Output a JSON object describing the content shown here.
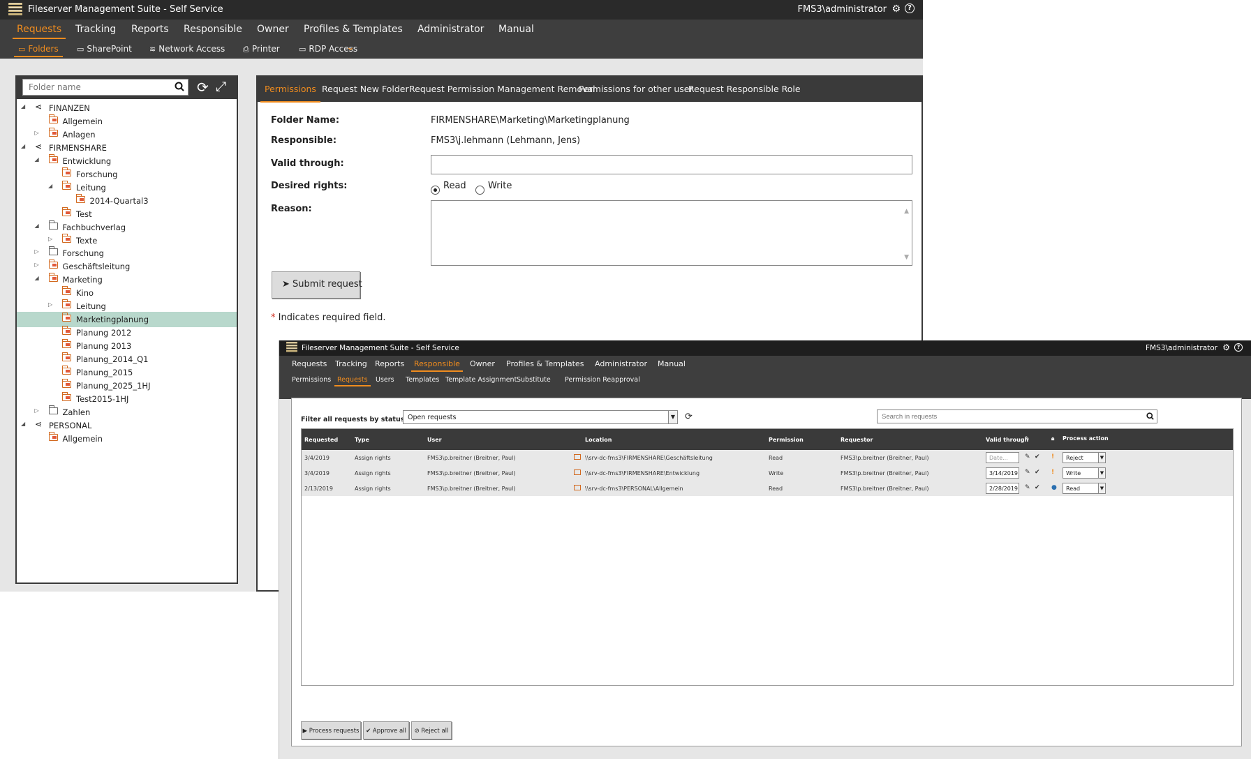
{
  "win1": {
    "title": "Fileserver Management Suite - Self Service",
    "user": "FMS3\\administrator",
    "mainnav": [
      "Requests",
      "Tracking",
      "Reports",
      "Responsible",
      "Owner",
      "Profiles & Templates",
      "Administrator",
      "Manual"
    ],
    "subnav": [
      "Folders",
      "SharePoint",
      "Network Access",
      "Printer",
      "RDP Access"
    ],
    "tree_search_placeholder": "Folder name",
    "tree": [
      {
        "label": "FINANZEN",
        "level": 0,
        "icon": "share",
        "toggle": "open"
      },
      {
        "label": "Allgemein",
        "level": 1,
        "icon": "folder-share",
        "toggle": ""
      },
      {
        "label": "Anlagen",
        "level": 1,
        "icon": "folder-share",
        "toggle": "closed"
      },
      {
        "label": "FIRMENSHARE",
        "level": 0,
        "icon": "share",
        "toggle": "open"
      },
      {
        "label": "Entwicklung",
        "level": 1,
        "icon": "folder-share",
        "toggle": "open"
      },
      {
        "label": "Forschung",
        "level": 2,
        "icon": "folder-share",
        "toggle": ""
      },
      {
        "label": "Leitung",
        "level": 2,
        "icon": "folder-share",
        "toggle": "open"
      },
      {
        "label": "2014-Quartal3",
        "level": 3,
        "icon": "folder-share",
        "toggle": ""
      },
      {
        "label": "Test",
        "level": 2,
        "icon": "folder-share",
        "toggle": ""
      },
      {
        "label": "Fachbuchverlag",
        "level": 1,
        "icon": "folder",
        "toggle": "open"
      },
      {
        "label": "Texte",
        "level": 2,
        "icon": "folder-share",
        "toggle": "closed"
      },
      {
        "label": "Forschung",
        "level": 1,
        "icon": "folder",
        "toggle": "closed"
      },
      {
        "label": "Geschäftsleitung",
        "level": 1,
        "icon": "folder-share",
        "toggle": "closed"
      },
      {
        "label": "Marketing",
        "level": 1,
        "icon": "folder-share",
        "toggle": "open"
      },
      {
        "label": "Kino",
        "level": 2,
        "icon": "folder-share",
        "toggle": ""
      },
      {
        "label": "Leitung",
        "level": 2,
        "icon": "folder-share",
        "toggle": "closed"
      },
      {
        "label": "Marketingplanung",
        "level": 2,
        "icon": "folder-share",
        "toggle": "",
        "selected": true
      },
      {
        "label": "Planung 2012",
        "level": 2,
        "icon": "folder-share",
        "toggle": ""
      },
      {
        "label": "Planung 2013",
        "level": 2,
        "icon": "folder-share",
        "toggle": ""
      },
      {
        "label": "Planung_2014_Q1",
        "level": 2,
        "icon": "folder-share",
        "toggle": ""
      },
      {
        "label": "Planung_2015",
        "level": 2,
        "icon": "folder-share",
        "toggle": ""
      },
      {
        "label": "Planung_2025_1HJ",
        "level": 2,
        "icon": "folder-share",
        "toggle": ""
      },
      {
        "label": "Test2015-1HJ",
        "level": 2,
        "icon": "folder-share",
        "toggle": ""
      },
      {
        "label": "Zahlen",
        "level": 1,
        "icon": "folder",
        "toggle": "closed"
      },
      {
        "label": "PERSONAL",
        "level": 0,
        "icon": "share",
        "toggle": "open"
      },
      {
        "label": "Allgemein",
        "level": 1,
        "icon": "folder-share",
        "toggle": ""
      }
    ],
    "tabs": [
      "Permissions",
      "Request New Folder",
      "Request Permission Management Removal",
      "Permissions for other user",
      "Request Responsible Role"
    ],
    "form": {
      "folder_name_label": "Folder Name:",
      "folder_name_value": "FIRMENSHARE\\Marketing\\Marketingplanung",
      "responsible_label": "Responsible:",
      "responsible_value": "FMS3\\j.lehmann (Lehmann, Jens)",
      "valid_label": "Valid through:",
      "rights_label": "Desired rights:",
      "read_label": "Read",
      "write_label": "Write",
      "reason_label": "Reason:",
      "submit_label": "Submit request",
      "required_star": "*",
      "required_note": " Indicates required field."
    }
  },
  "win2": {
    "title": "Fileserver Management Suite - Self Service",
    "user": "FMS3\\administrator",
    "mainnav": [
      "Requests",
      "Tracking",
      "Reports",
      "Responsible",
      "Owner",
      "Profiles & Templates",
      "Administrator",
      "Manual"
    ],
    "subnav": [
      "Permissions",
      "Requests",
      "Users",
      "Templates",
      "Template Assignment",
      "Substitute",
      "Permission Reapproval"
    ],
    "filter_label": "Filter all requests by status:",
    "filter_value": "Open requests",
    "search_placeholder": "Search in requests",
    "columns": [
      "Requested",
      "Type",
      "User",
      "Location",
      "Permission",
      "Requestor",
      "Valid through",
      "Process action"
    ],
    "rows": [
      {
        "requested": "3/4/2019",
        "type": "Assign rights",
        "user": "FMS3\\p.breitner (Breitner, Paul)",
        "location": "\\\\srv-dc-fms3\\FIRMENSHARE\\Geschäftsleitung",
        "permission": "Read",
        "requestor": "FMS3\\p.breitner (Breitner, Paul)",
        "valid": "Date...",
        "status": "!",
        "action": "Reject"
      },
      {
        "requested": "3/4/2019",
        "type": "Assign rights",
        "user": "FMS3\\p.breitner (Breitner, Paul)",
        "location": "\\\\srv-dc-fms3\\FIRMENSHARE\\Entwicklung",
        "permission": "Write",
        "requestor": "FMS3\\p.breitner (Breitner, Paul)",
        "valid": "3/14/2019",
        "status": "!",
        "action": "Write"
      },
      {
        "requested": "2/13/2019",
        "type": "Assign rights",
        "user": "FMS3\\p.breitner (Breitner, Paul)",
        "location": "\\\\srv-dc-fms3\\PERSONAL\\Allgemein",
        "permission": "Read",
        "requestor": "FMS3\\p.breitner (Breitner, Paul)",
        "valid": "2/28/2019",
        "status": "user",
        "action": "Read"
      }
    ],
    "buttons": [
      "Process requests",
      "Approve all",
      "Reject all"
    ]
  },
  "colors": {
    "accent": "#f08c1e",
    "nav_bg": "#3e3e3e",
    "title_bg": "#2a2a2a",
    "selected_row": "#b8d8cc"
  }
}
